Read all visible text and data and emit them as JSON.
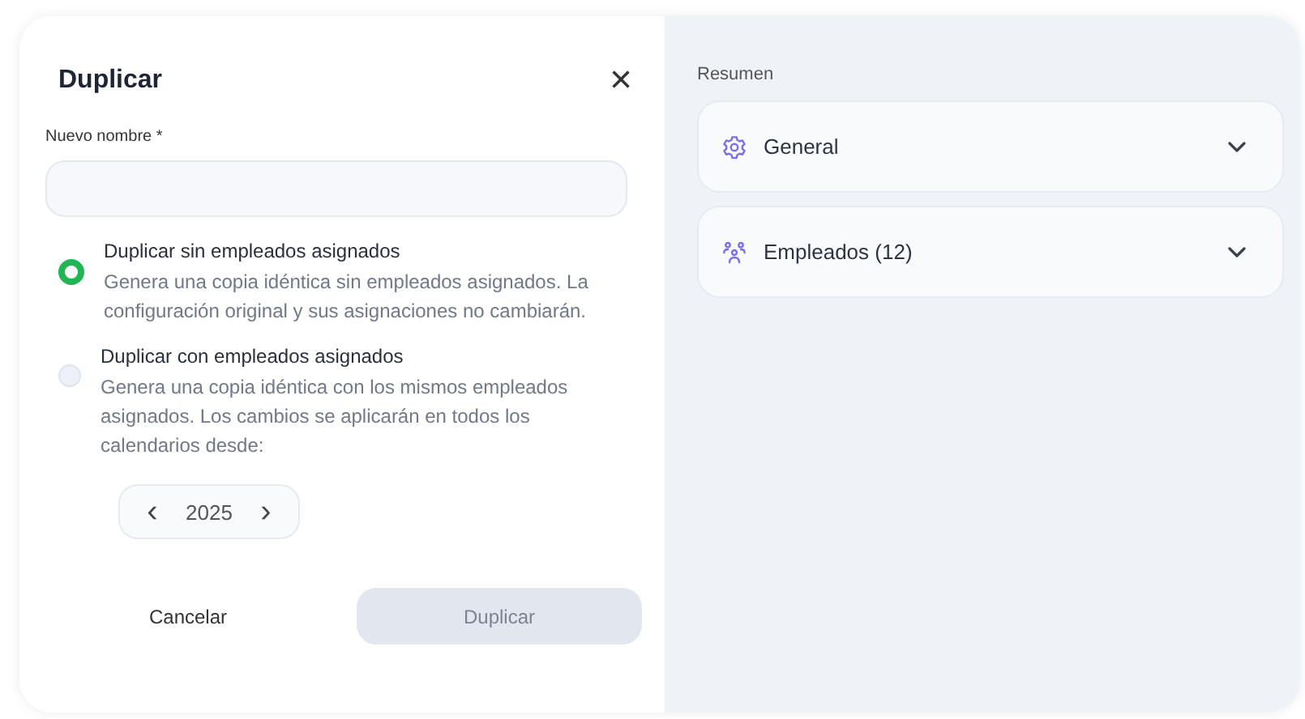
{
  "dialog": {
    "title": "Duplicar",
    "close": "×"
  },
  "name_field": {
    "label": "Nuevo nombre *"
  },
  "options": [
    {
      "title": "Duplicar sin empleados asignados",
      "description": "Genera una copia idéntica sin empleados asignados. La configuración original y sus asignaciones no cambiarán.",
      "selected": true
    },
    {
      "title": "Duplicar con empleados asignados",
      "description": "Genera una copia idéntica con los mismos empleados asignados. Los cambios se aplicarán en todos los calendarios desde:",
      "selected": false
    }
  ],
  "year_stepper": {
    "prev": "‹",
    "value": "2025",
    "next": "›"
  },
  "buttons": [
    {
      "label": "Cancelar",
      "kind": "text",
      "disabled": false
    },
    {
      "label": "Duplicar",
      "kind": "primary",
      "disabled": true
    }
  ],
  "summary": {
    "title": "Resumen",
    "sections": [
      {
        "kind": "gear",
        "label": "General",
        "expanded": false
      },
      {
        "kind": "people",
        "label": "Empleados (12)",
        "expanded": false
      }
    ]
  }
}
